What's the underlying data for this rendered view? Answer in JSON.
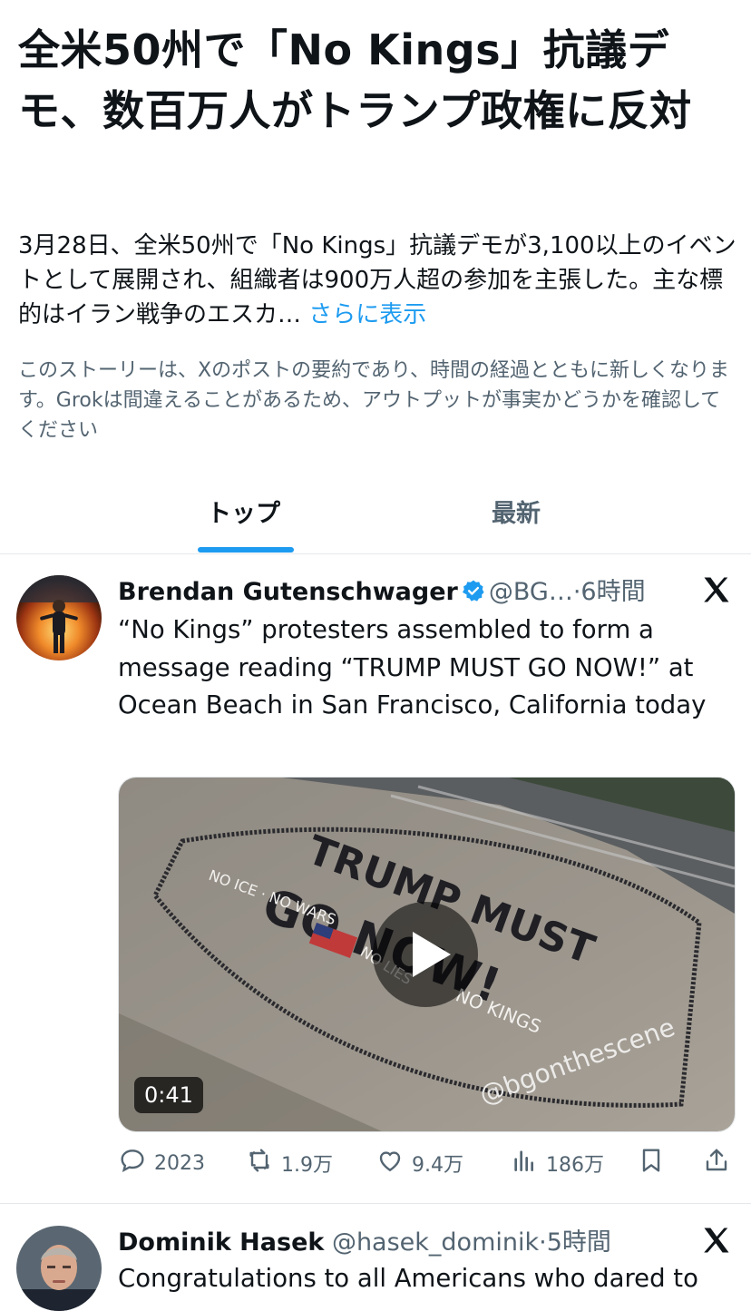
{
  "headline": "全米50州で「No Kings」抗議デモ、数百万人がトランプ政権に反対",
  "summary": {
    "text": "3月28日、全米50州で「No Kings」抗議デモが3,100以上のイベントとして展開され、組織者は900万人超の参加を主張した。主な標的はイラン戦争のエスカ… ",
    "more_label": "さらに表示"
  },
  "disclaimer": "このストーリーは、Xのポストの要約であり、時間の経過とともに新しくなります。Grokは間違えることがあるため、アウトプットが事実かどうかを確認してください",
  "tabs": [
    {
      "label": "トップ",
      "selected": true
    },
    {
      "label": "最新",
      "selected": false
    }
  ],
  "posts": [
    {
      "name": "Brendan Gutenschwager",
      "verified": true,
      "handle": "@BG…",
      "time": "·6時間",
      "text": "“No Kings” protesters assembled to form a message reading “TRUMP MUST GO NOW!” at Ocean Beach in San Francisco, California today",
      "video": {
        "duration": "0:41",
        "overlay_text": [
          "TRUMP MUST",
          "GO NOW!",
          "NO ICE · NO WARS",
          "NO LIES",
          "NO KINGS"
        ],
        "watermark": "@bgonthescene"
      },
      "stats": {
        "replies": "2023",
        "reposts": "1.9万",
        "likes": "9.4万",
        "views": "186万"
      }
    },
    {
      "name": "Dominik Hasek",
      "verified": false,
      "handle": "@hasek_dominik",
      "time": "·5時間",
      "text": "Congratulations to all Americans who dared to"
    }
  ],
  "colors": {
    "accent": "#1d9bf0",
    "secondary_text": "#536471",
    "divider": "#e6e9eb"
  },
  "icons": [
    "x-logo-icon",
    "verified-badge-icon",
    "play-icon",
    "reply-icon",
    "repost-icon",
    "like-icon",
    "views-icon",
    "bookmark-icon",
    "share-icon"
  ]
}
